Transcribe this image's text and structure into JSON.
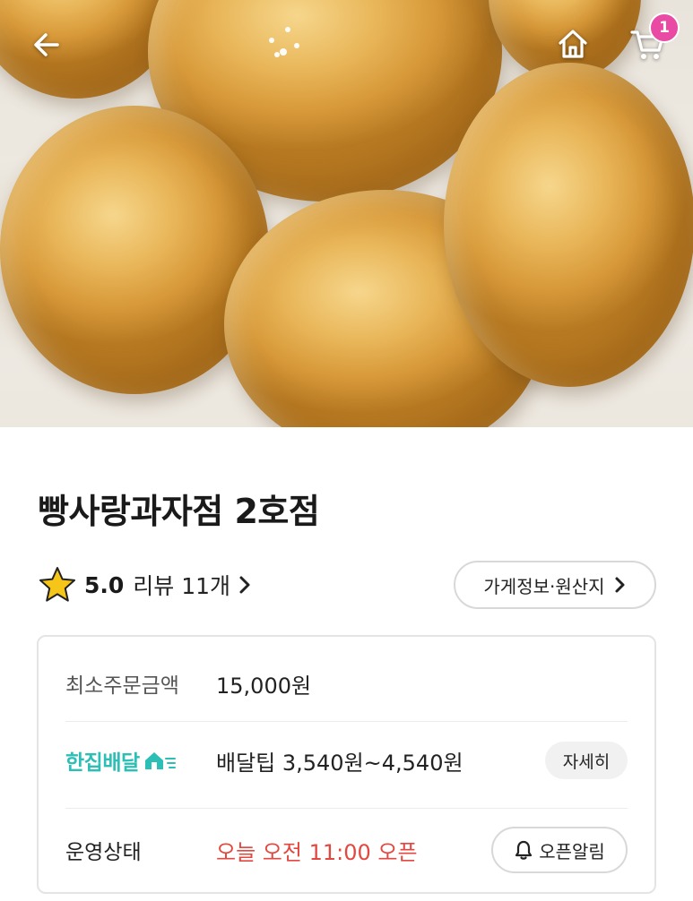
{
  "header": {
    "back_icon": "arrow-left-icon",
    "home_icon": "home-icon",
    "cart_icon": "cart-icon",
    "cart_count": "1",
    "badge_color": "#e84aa4"
  },
  "store": {
    "name": "빵사랑과자점 2호점",
    "rating": "5.0",
    "review_label": "리뷰 11개",
    "info_button_label": "가게정보·원산지"
  },
  "info": {
    "min_order_label": "최소주문금액",
    "min_order_value": "15,000원",
    "delivery_brand": "한집배달",
    "delivery_tip": "배달팁 3,540원~4,540원",
    "detail_button_label": "자세히",
    "status_label": "운영상태",
    "status_value": "오늘 오전 11:00 오픈",
    "open_alarm_label": "오픈알림",
    "brand_color": "#2cbfb5",
    "status_color": "#e2483f"
  }
}
